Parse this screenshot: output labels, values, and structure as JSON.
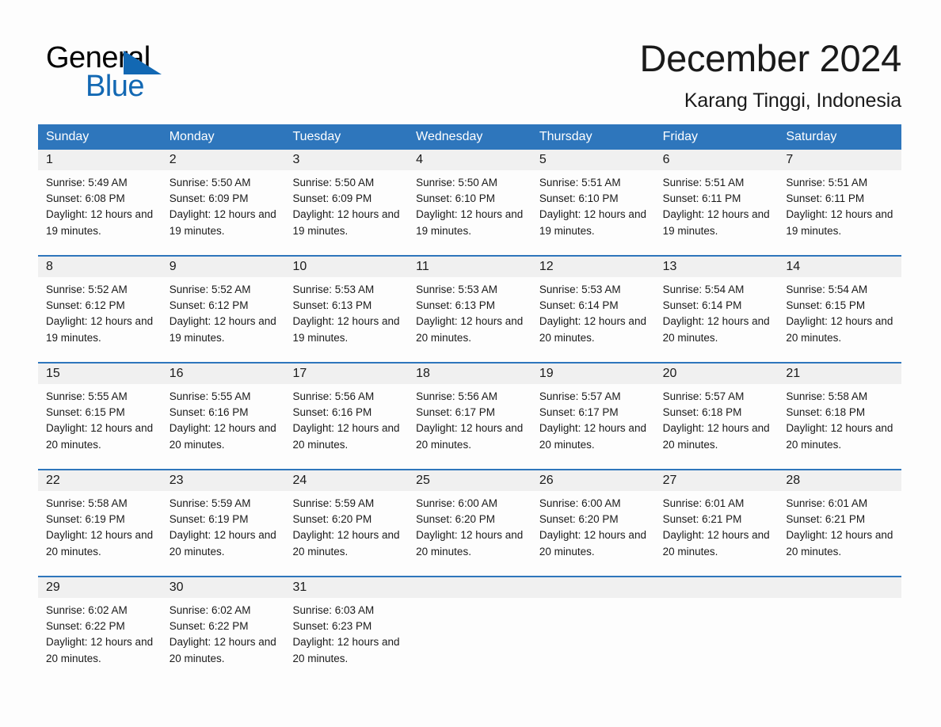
{
  "brand": {
    "name_part1": "General",
    "name_part2": "Blue",
    "triangle_icon": "triangle-icon",
    "accent_color": "#1268b3"
  },
  "header": {
    "title": "December 2024",
    "location": "Karang Tinggi, Indonesia"
  },
  "calendar": {
    "header_color": "#2e76bc",
    "date_band_color": "#f0f0f0",
    "weekdays": [
      "Sunday",
      "Monday",
      "Tuesday",
      "Wednesday",
      "Thursday",
      "Friday",
      "Saturday"
    ],
    "labels": {
      "sunrise_prefix": "Sunrise:",
      "sunset_prefix": "Sunset:",
      "daylight_prefix": "Daylight:"
    },
    "weeks": [
      [
        {
          "day": "1",
          "sunrise": "Sunrise: 5:49 AM",
          "sunset": "Sunset: 6:08 PM",
          "daylight": "Daylight: 12 hours and 19 minutes."
        },
        {
          "day": "2",
          "sunrise": "Sunrise: 5:50 AM",
          "sunset": "Sunset: 6:09 PM",
          "daylight": "Daylight: 12 hours and 19 minutes."
        },
        {
          "day": "3",
          "sunrise": "Sunrise: 5:50 AM",
          "sunset": "Sunset: 6:09 PM",
          "daylight": "Daylight: 12 hours and 19 minutes."
        },
        {
          "day": "4",
          "sunrise": "Sunrise: 5:50 AM",
          "sunset": "Sunset: 6:10 PM",
          "daylight": "Daylight: 12 hours and 19 minutes."
        },
        {
          "day": "5",
          "sunrise": "Sunrise: 5:51 AM",
          "sunset": "Sunset: 6:10 PM",
          "daylight": "Daylight: 12 hours and 19 minutes."
        },
        {
          "day": "6",
          "sunrise": "Sunrise: 5:51 AM",
          "sunset": "Sunset: 6:11 PM",
          "daylight": "Daylight: 12 hours and 19 minutes."
        },
        {
          "day": "7",
          "sunrise": "Sunrise: 5:51 AM",
          "sunset": "Sunset: 6:11 PM",
          "daylight": "Daylight: 12 hours and 19 minutes."
        }
      ],
      [
        {
          "day": "8",
          "sunrise": "Sunrise: 5:52 AM",
          "sunset": "Sunset: 6:12 PM",
          "daylight": "Daylight: 12 hours and 19 minutes."
        },
        {
          "day": "9",
          "sunrise": "Sunrise: 5:52 AM",
          "sunset": "Sunset: 6:12 PM",
          "daylight": "Daylight: 12 hours and 19 minutes."
        },
        {
          "day": "10",
          "sunrise": "Sunrise: 5:53 AM",
          "sunset": "Sunset: 6:13 PM",
          "daylight": "Daylight: 12 hours and 19 minutes."
        },
        {
          "day": "11",
          "sunrise": "Sunrise: 5:53 AM",
          "sunset": "Sunset: 6:13 PM",
          "daylight": "Daylight: 12 hours and 20 minutes."
        },
        {
          "day": "12",
          "sunrise": "Sunrise: 5:53 AM",
          "sunset": "Sunset: 6:14 PM",
          "daylight": "Daylight: 12 hours and 20 minutes."
        },
        {
          "day": "13",
          "sunrise": "Sunrise: 5:54 AM",
          "sunset": "Sunset: 6:14 PM",
          "daylight": "Daylight: 12 hours and 20 minutes."
        },
        {
          "day": "14",
          "sunrise": "Sunrise: 5:54 AM",
          "sunset": "Sunset: 6:15 PM",
          "daylight": "Daylight: 12 hours and 20 minutes."
        }
      ],
      [
        {
          "day": "15",
          "sunrise": "Sunrise: 5:55 AM",
          "sunset": "Sunset: 6:15 PM",
          "daylight": "Daylight: 12 hours and 20 minutes."
        },
        {
          "day": "16",
          "sunrise": "Sunrise: 5:55 AM",
          "sunset": "Sunset: 6:16 PM",
          "daylight": "Daylight: 12 hours and 20 minutes."
        },
        {
          "day": "17",
          "sunrise": "Sunrise: 5:56 AM",
          "sunset": "Sunset: 6:16 PM",
          "daylight": "Daylight: 12 hours and 20 minutes."
        },
        {
          "day": "18",
          "sunrise": "Sunrise: 5:56 AM",
          "sunset": "Sunset: 6:17 PM",
          "daylight": "Daylight: 12 hours and 20 minutes."
        },
        {
          "day": "19",
          "sunrise": "Sunrise: 5:57 AM",
          "sunset": "Sunset: 6:17 PM",
          "daylight": "Daylight: 12 hours and 20 minutes."
        },
        {
          "day": "20",
          "sunrise": "Sunrise: 5:57 AM",
          "sunset": "Sunset: 6:18 PM",
          "daylight": "Daylight: 12 hours and 20 minutes."
        },
        {
          "day": "21",
          "sunrise": "Sunrise: 5:58 AM",
          "sunset": "Sunset: 6:18 PM",
          "daylight": "Daylight: 12 hours and 20 minutes."
        }
      ],
      [
        {
          "day": "22",
          "sunrise": "Sunrise: 5:58 AM",
          "sunset": "Sunset: 6:19 PM",
          "daylight": "Daylight: 12 hours and 20 minutes."
        },
        {
          "day": "23",
          "sunrise": "Sunrise: 5:59 AM",
          "sunset": "Sunset: 6:19 PM",
          "daylight": "Daylight: 12 hours and 20 minutes."
        },
        {
          "day": "24",
          "sunrise": "Sunrise: 5:59 AM",
          "sunset": "Sunset: 6:20 PM",
          "daylight": "Daylight: 12 hours and 20 minutes."
        },
        {
          "day": "25",
          "sunrise": "Sunrise: 6:00 AM",
          "sunset": "Sunset: 6:20 PM",
          "daylight": "Daylight: 12 hours and 20 minutes."
        },
        {
          "day": "26",
          "sunrise": "Sunrise: 6:00 AM",
          "sunset": "Sunset: 6:20 PM",
          "daylight": "Daylight: 12 hours and 20 minutes."
        },
        {
          "day": "27",
          "sunrise": "Sunrise: 6:01 AM",
          "sunset": "Sunset: 6:21 PM",
          "daylight": "Daylight: 12 hours and 20 minutes."
        },
        {
          "day": "28",
          "sunrise": "Sunrise: 6:01 AM",
          "sunset": "Sunset: 6:21 PM",
          "daylight": "Daylight: 12 hours and 20 minutes."
        }
      ],
      [
        {
          "day": "29",
          "sunrise": "Sunrise: 6:02 AM",
          "sunset": "Sunset: 6:22 PM",
          "daylight": "Daylight: 12 hours and 20 minutes."
        },
        {
          "day": "30",
          "sunrise": "Sunrise: 6:02 AM",
          "sunset": "Sunset: 6:22 PM",
          "daylight": "Daylight: 12 hours and 20 minutes."
        },
        {
          "day": "31",
          "sunrise": "Sunrise: 6:03 AM",
          "sunset": "Sunset: 6:23 PM",
          "daylight": "Daylight: 12 hours and 20 minutes."
        },
        {
          "day": "",
          "sunrise": "",
          "sunset": "",
          "daylight": ""
        },
        {
          "day": "",
          "sunrise": "",
          "sunset": "",
          "daylight": ""
        },
        {
          "day": "",
          "sunrise": "",
          "sunset": "",
          "daylight": ""
        },
        {
          "day": "",
          "sunrise": "",
          "sunset": "",
          "daylight": ""
        }
      ]
    ]
  }
}
